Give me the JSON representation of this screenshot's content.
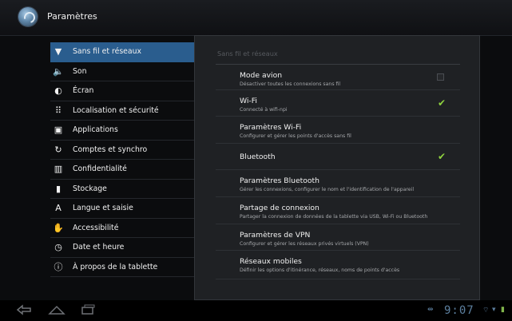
{
  "header": {
    "title": "Paramètres",
    "app_icon": "settings-app-icon"
  },
  "sidebar": {
    "items": [
      {
        "label": "Sans fil et réseaux",
        "icon": "wifi-icon",
        "glyph": "▼",
        "selected": true
      },
      {
        "label": "Son",
        "icon": "speaker-icon",
        "glyph": "🔈",
        "selected": false
      },
      {
        "label": "Écran",
        "icon": "brightness-icon",
        "glyph": "◐",
        "selected": false
      },
      {
        "label": "Localisation et sécurité",
        "icon": "grid-icon",
        "glyph": "⠿",
        "selected": false
      },
      {
        "label": "Applications",
        "icon": "applications-icon",
        "glyph": "▣",
        "selected": false
      },
      {
        "label": "Comptes et synchro",
        "icon": "sync-icon",
        "glyph": "↻",
        "selected": false
      },
      {
        "label": "Confidentialité",
        "icon": "privacy-icon",
        "glyph": "▥",
        "selected": false
      },
      {
        "label": "Stockage",
        "icon": "storage-icon",
        "glyph": "▮",
        "selected": false
      },
      {
        "label": "Langue et saisie",
        "icon": "keyboard-letter-icon",
        "glyph": "A",
        "selected": false
      },
      {
        "label": "Accessibilité",
        "icon": "hand-icon",
        "glyph": "✋",
        "selected": false
      },
      {
        "label": "Date et heure",
        "icon": "clock-icon",
        "glyph": "◷",
        "selected": false
      },
      {
        "label": "À propos de la tablette",
        "icon": "info-icon",
        "glyph": "ⓘ",
        "selected": false
      }
    ]
  },
  "panel": {
    "header": "Sans fil et réseaux",
    "settings": [
      {
        "title": "Mode avion",
        "summary": "Désactiver toutes les connexions sans fil",
        "control": "checkbox",
        "checked": false
      },
      {
        "title": "Wi-Fi",
        "summary": "Connecté à wifi-npi",
        "control": "checkbox",
        "checked": true
      },
      {
        "title": "Paramètres Wi-Fi",
        "summary": "Configurer et gérer les points d'accès sans fil",
        "control": "none",
        "checked": false
      },
      {
        "title": "Bluetooth",
        "summary": "",
        "control": "checkbox",
        "checked": true
      },
      {
        "title": "Paramètres Bluetooth",
        "summary": "Gérer les connexions, configurer le nom et l'identification de l'appareil",
        "control": "none",
        "checked": false
      },
      {
        "title": "Partage de connexion",
        "summary": "Partager la connexion de données de la tablette via USB, Wi-Fi ou Bluetooth",
        "control": "none",
        "checked": false
      },
      {
        "title": "Paramètres de VPN",
        "summary": "Configurer et gérer les réseaux privés virtuels (VPN)",
        "control": "none",
        "checked": false
      },
      {
        "title": "Réseaux mobiles",
        "summary": "Définir les options d'itinérance, réseaux, noms de points d'accès",
        "control": "none",
        "checked": false
      }
    ]
  },
  "system_bar": {
    "clock": "9:07",
    "back_icon": "back-icon",
    "home_icon": "home-icon",
    "recents_icon": "recent-apps-icon",
    "accent": "#5c7f9e"
  },
  "colors": {
    "selected": "#2a5d8e",
    "checkmark": "#8fd23f",
    "panel": "#1f2124"
  }
}
